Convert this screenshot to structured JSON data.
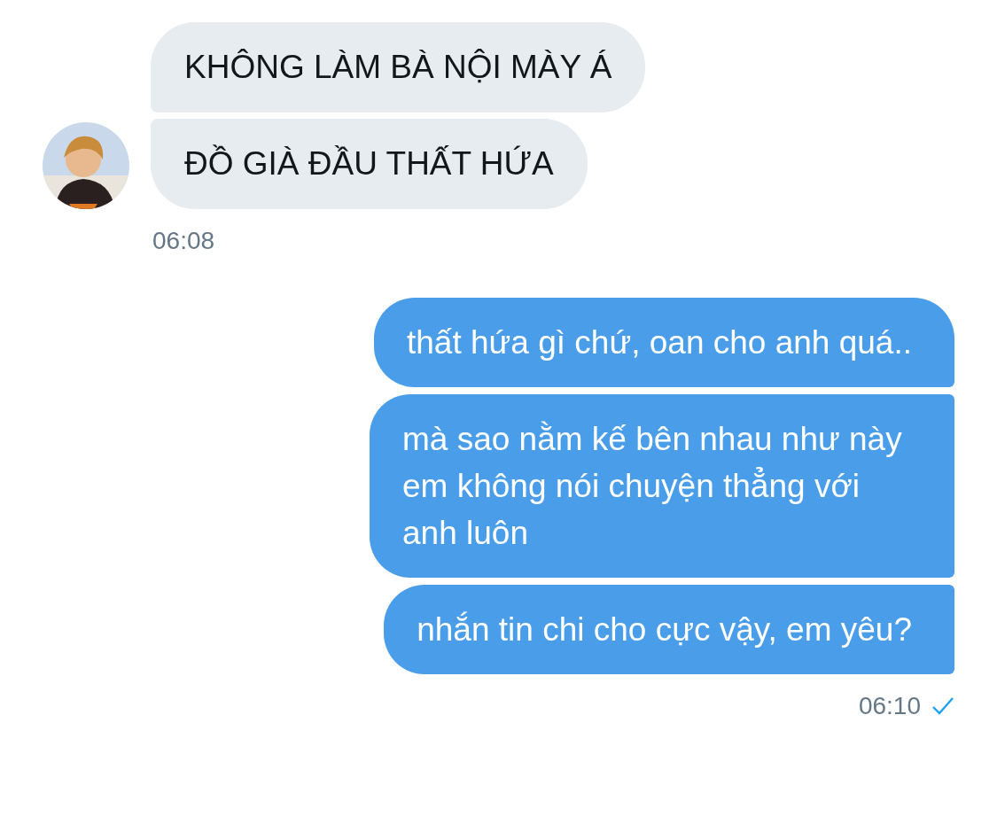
{
  "received": {
    "messages": [
      "KHÔNG LÀM BÀ NỘI MÀY Á",
      "ĐỒ GIÀ ĐẦU THẤT HỨA"
    ],
    "time": "06:08"
  },
  "sent": {
    "messages": [
      "thất hứa gì chứ, oan cho anh quá..",
      "mà sao nằm kế bên nhau như này em không nói chuyện thẳng với anh luôn",
      "nhắn tin chi cho cực vậy, em yêu?"
    ],
    "time": "06:10",
    "read": true
  }
}
